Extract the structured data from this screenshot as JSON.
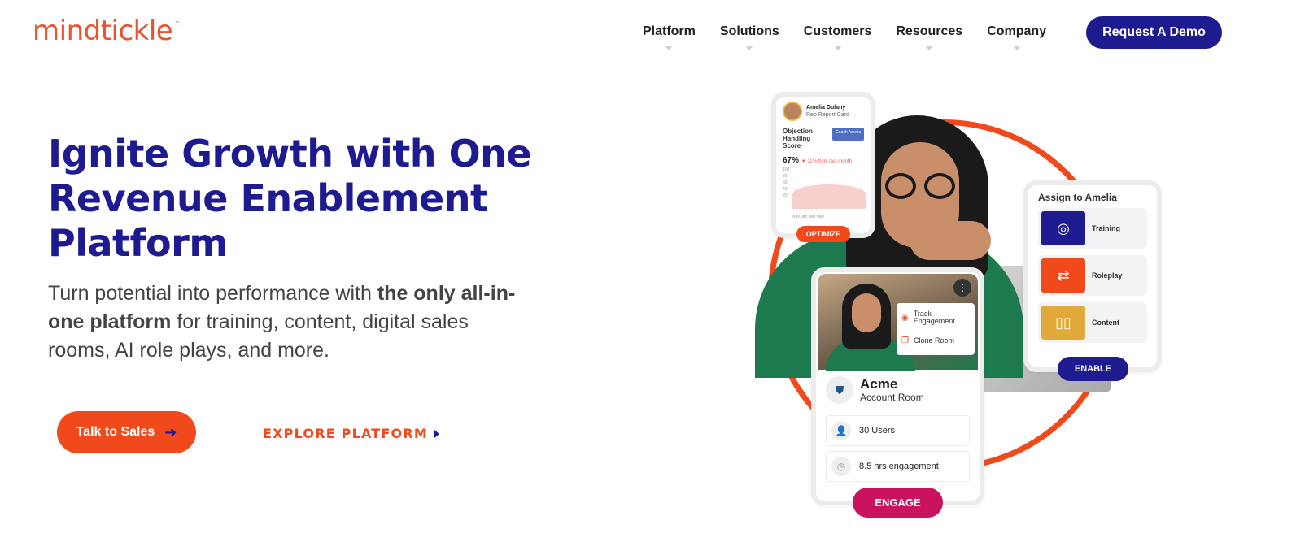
{
  "header": {
    "logo_text": "mindtickle",
    "logo_mark": "™",
    "nav": [
      "Platform",
      "Solutions",
      "Customers",
      "Resources",
      "Company"
    ],
    "cta": "Request A Demo"
  },
  "hero": {
    "title": "Ignite Growth with One Revenue Enablement Platform",
    "subtitle_pre": "Turn potential into performance with ",
    "subtitle_bold": "the only all-in-one platform",
    "subtitle_post": " for training, content, digital sales rooms, AI role plays, and more.",
    "primary_cta": "Talk to Sales",
    "secondary_cta": "EXPLORE PLATFORM"
  },
  "report_card": {
    "name": "Amelia Dulany",
    "subtitle": "Rep Report Card",
    "metric_label": "Objection Handling Score",
    "coach_button": "Coach Amelia",
    "score": "67%",
    "trend": "▼ 11% from last month",
    "y_ticks": "100 80 60 40 20",
    "x_ticks": "Nov   Jan   Mar   May",
    "action": "OPTIMIZE"
  },
  "assign_card": {
    "title": "Assign to Amelia",
    "options": [
      {
        "label": "Training",
        "icon": "target-icon",
        "color": "#1d1b8f"
      },
      {
        "label": "Roleplay",
        "icon": "people-swap-icon",
        "color": "#f04a1c"
      },
      {
        "label": "Content",
        "icon": "book-icon",
        "color": "#e0a93a"
      }
    ],
    "action": "ENABLE"
  },
  "room_card": {
    "menu": [
      "Track Engagement",
      "Clone Room"
    ],
    "account_name": "Acme",
    "account_type": "Account Room",
    "stats": [
      "30 Users",
      "8.5 hrs engagement"
    ],
    "action": "ENGAGE"
  },
  "colors": {
    "brand_navy": "#1d1b8f",
    "brand_orange": "#f04a1c",
    "engage_magenta": "#c9135e"
  }
}
